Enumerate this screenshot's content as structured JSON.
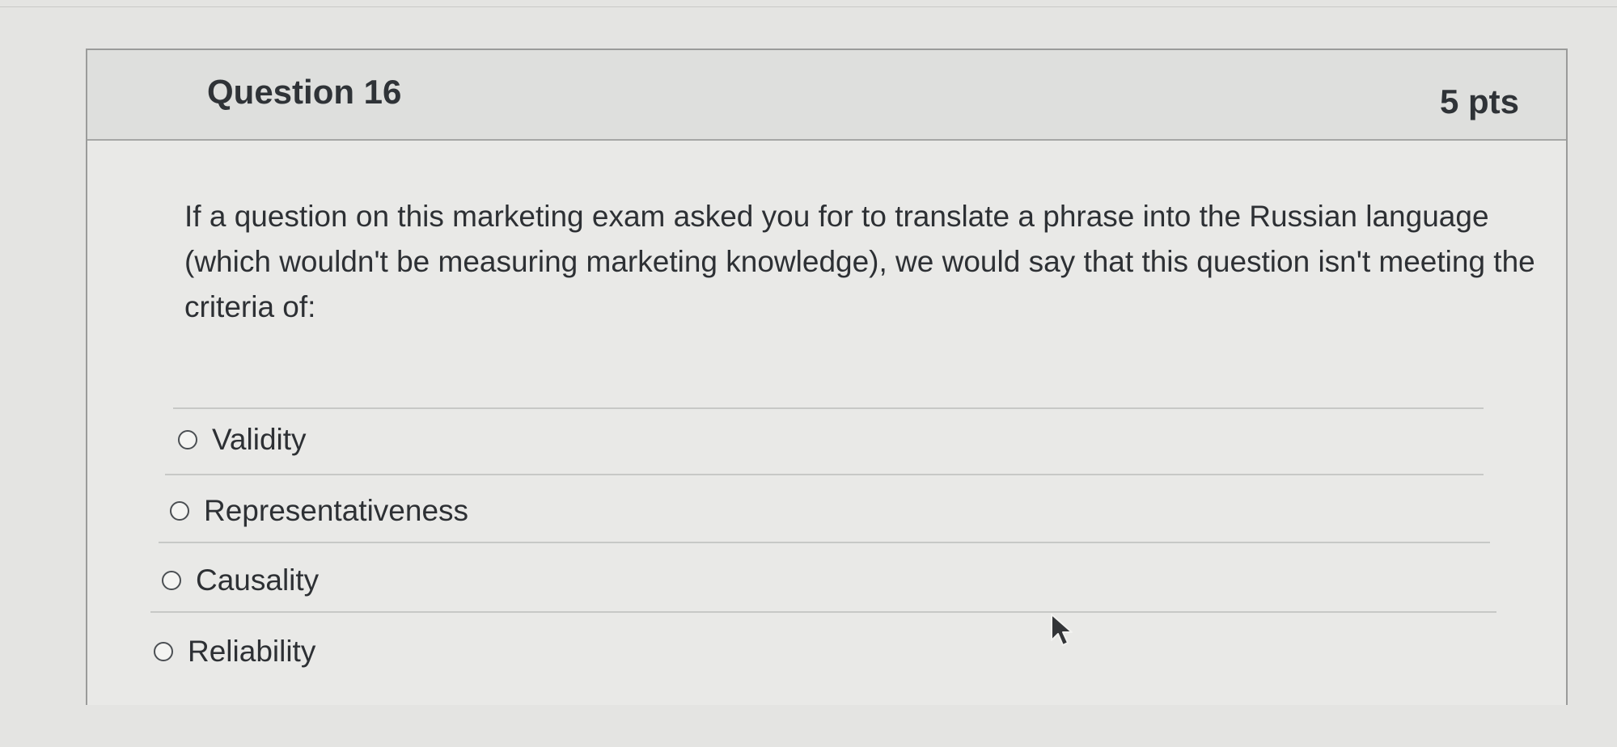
{
  "question": {
    "title": "Question 16",
    "points": "5 pts",
    "text": "If a question on this marketing exam asked you for to translate a phrase into the Russian language (which wouldn't be measuring marketing knowledge), we would say that this question isn't meeting the criteria of:"
  },
  "answers": [
    {
      "label": "Validity"
    },
    {
      "label": "Representativeness"
    },
    {
      "label": "Causality"
    },
    {
      "label": "Reliability"
    }
  ],
  "icons": {
    "radio": "radio-button-icon",
    "cursor": "mouse-pointer-icon"
  },
  "colors": {
    "text": "#2d3034",
    "border": "#9a9b9a",
    "background": "#e8e8e6"
  }
}
